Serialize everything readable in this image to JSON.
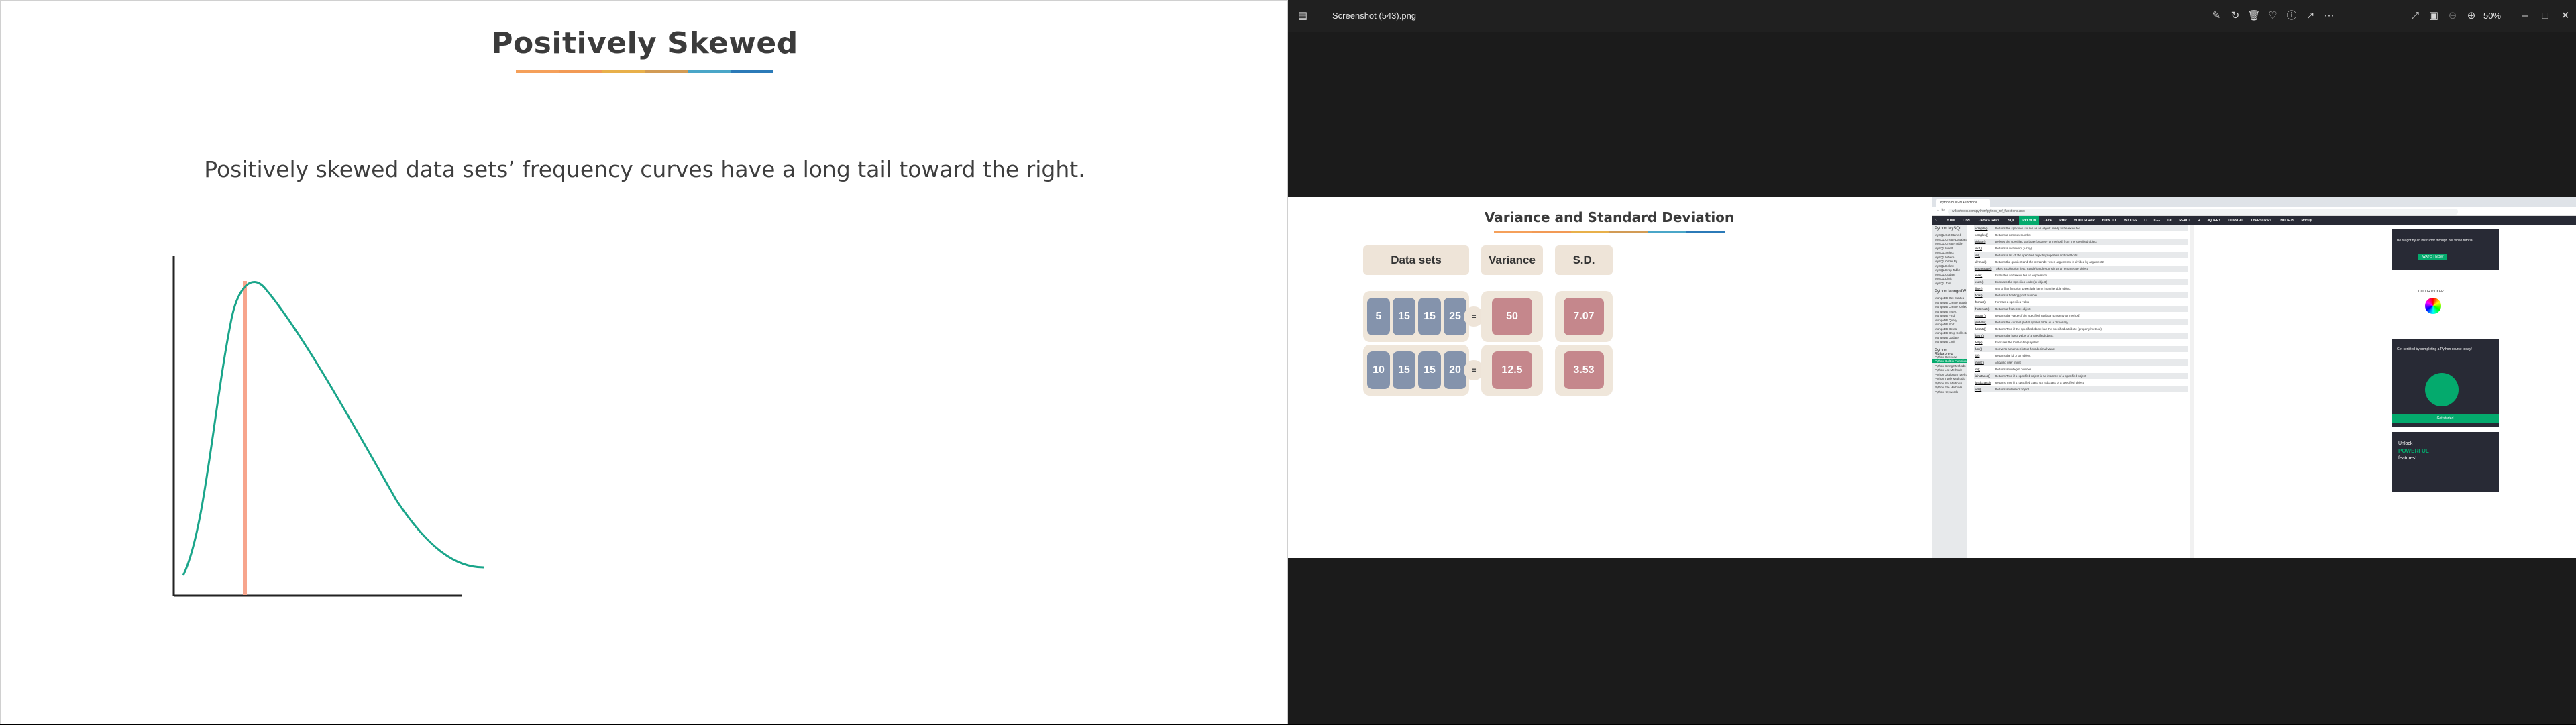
{
  "left_slide": {
    "title": "Positively Skewed",
    "title_rule_colors": [
      "#f5a05a",
      "#f29a55",
      "#e8b04a",
      "#d29b55",
      "#4aa6c8",
      "#2b7ab8"
    ],
    "description": "Positively skewed data sets’ frequency curves have a long tail toward the right.",
    "curve_color": "#1aa58a",
    "marker_color": "#f7a58d"
  },
  "viewer": {
    "file_name": "Screenshot (543).png",
    "zoom": "50%",
    "icons": [
      "image-edit-icon",
      "rotate-icon",
      "delete-icon",
      "favorite-icon",
      "info-icon",
      "share-icon",
      "more-icon",
      "fullscreen-icon",
      "slideshow-icon",
      "zoom-out-icon",
      "zoom-in-icon",
      "minimize-icon",
      "maximize-icon",
      "close-icon"
    ]
  },
  "variance_slide": {
    "title": "Variance and Standard Deviation",
    "headers": [
      "Data sets",
      "Variance",
      "S.D."
    ],
    "rows": [
      {
        "values": [
          "5",
          "15",
          "15",
          "25"
        ],
        "variance": "50",
        "sd": "7.07"
      },
      {
        "values": [
          "10",
          "15",
          "15",
          "20"
        ],
        "variance": "12.5",
        "sd": "3.53"
      }
    ],
    "equals": "="
  },
  "browser": {
    "tab_label": "Python Built-in Functions",
    "url": "w3schools.com/python/python_ref_functions.asp",
    "nav": [
      "HTML",
      "CSS",
      "JAVASCRIPT",
      "SQL",
      "PYTHON",
      "JAVA",
      "PHP",
      "BOOTSTRAP",
      "HOW TO",
      "W3.CSS",
      "C",
      "C++",
      "C#",
      "REACT",
      "R",
      "JQUERY",
      "DJANGO",
      "TYPESCRIPT",
      "NODEJS",
      "MYSQL"
    ],
    "active_nav": "PYTHON",
    "sidebar": {
      "mysql_head": "Python MySQL",
      "mysql_items": [
        "MySQL Get Started",
        "MySQL Create Database",
        "MySQL Create Table",
        "MySQL Insert",
        "MySQL Select",
        "MySQL Where",
        "MySQL Order By",
        "MySQL Delete",
        "MySQL Drop Table",
        "MySQL Update",
        "MySQL Limit",
        "MySQL Join"
      ],
      "mongo_head": "Python MongoDB",
      "mongo_items": [
        "MongoDB Get Started",
        "MongoDB Create Database",
        "MongoDB Create Collection",
        "MongoDB Insert",
        "MongoDB Find",
        "MongoDB Query",
        "MongoDB Sort",
        "MongoDB Delete",
        "MongoDB Drop Collection",
        "MongoDB Update",
        "MongoDB Limit"
      ],
      "ref_head": "Python Reference",
      "ref_items": [
        "Python Overview",
        "Python Built-in Functions",
        "Python String Methods",
        "Python List Methods",
        "Python Dictionary Methods",
        "Python Tuple Methods",
        "Python Set Methods",
        "Python File Methods",
        "Python Keywords"
      ],
      "active_item": "Python Built-in Functions"
    },
    "functions": [
      [
        "compile()",
        "Returns the specified source as an object, ready to be executed"
      ],
      [
        "complex()",
        "Returns a complex number"
      ],
      [
        "delattr()",
        "Deletes the specified attribute (property or method) from the specified object"
      ],
      [
        "dict()",
        "Returns a dictionary (Array)"
      ],
      [
        "dir()",
        "Returns a list of the specified object's properties and methods"
      ],
      [
        "divmod()",
        "Returns the quotient and the remainder when argument1 is divided by argument2"
      ],
      [
        "enumerate()",
        "Takes a collection (e.g. a tuple) and returns it as an enumerate object"
      ],
      [
        "eval()",
        "Evaluates and executes an expression"
      ],
      [
        "exec()",
        "Executes the specified code (or object)"
      ],
      [
        "filter()",
        "Use a filter function to exclude items in an iterable object"
      ],
      [
        "float()",
        "Returns a floating point number"
      ],
      [
        "format()",
        "Formats a specified value"
      ],
      [
        "frozenset()",
        "Returns a frozenset object"
      ],
      [
        "getattr()",
        "Returns the value of the specified attribute (property or method)"
      ],
      [
        "globals()",
        "Returns the current global symbol table as a dictionary"
      ],
      [
        "hasattr()",
        "Returns True if the specified object has the specified attribute (property/method)"
      ],
      [
        "hash()",
        "Returns the hash value of a specified object"
      ],
      [
        "help()",
        "Executes the built-in help system"
      ],
      [
        "hex()",
        "Converts a number into a hexadecimal value"
      ],
      [
        "id()",
        "Returns the id of an object"
      ],
      [
        "input()",
        "Allowing user input"
      ],
      [
        "int()",
        "Returns an integer number"
      ],
      [
        "isinstance()",
        "Returns True if a specified object is an instance of a specified object"
      ],
      [
        "issubclass()",
        "Returns True if a specified class is a subclass of a specified object"
      ],
      [
        "iter()",
        "Returns an iterator object"
      ]
    ],
    "ads": {
      "course_promo": "Be taught by an instructor through our video tutorial",
      "watch": "WATCH NOW",
      "color_picker": "COLOR PICKER",
      "cert_text": "Get certified by completing a Python course today!",
      "get_started": "Get started",
      "unlock": "Unlock",
      "powerful": "POWERFUL",
      "features": "features!"
    }
  }
}
